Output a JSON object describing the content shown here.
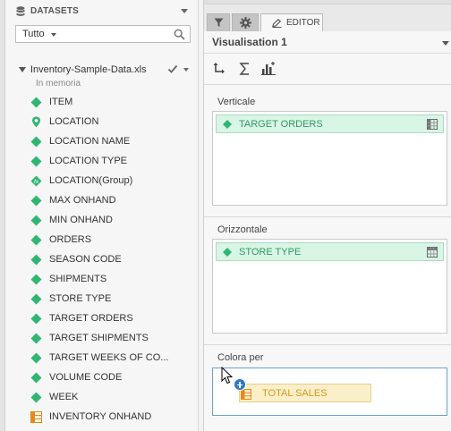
{
  "datasets": {
    "title": "DATASETS",
    "filter_value": "Tutto",
    "file_name": "Inventory-Sample-Data.xls",
    "file_status": "In memoria",
    "fields": [
      {
        "label": "ITEM",
        "type": "dimension",
        "icon": "diamond-icon"
      },
      {
        "label": "LOCATION",
        "type": "geo",
        "icon": "location-pin-icon"
      },
      {
        "label": "LOCATION NAME",
        "type": "dimension",
        "icon": "diamond-icon"
      },
      {
        "label": "LOCATION TYPE",
        "type": "dimension",
        "icon": "diamond-icon"
      },
      {
        "label": "LOCATION(Group)",
        "type": "calculated",
        "icon": "fx-icon"
      },
      {
        "label": "MAX ONHAND",
        "type": "dimension",
        "icon": "diamond-icon"
      },
      {
        "label": "MIN ONHAND",
        "type": "dimension",
        "icon": "diamond-icon"
      },
      {
        "label": "ORDERS",
        "type": "dimension",
        "icon": "diamond-icon"
      },
      {
        "label": "SEASON CODE",
        "type": "dimension",
        "icon": "diamond-icon"
      },
      {
        "label": "SHIPMENTS",
        "type": "dimension",
        "icon": "diamond-icon"
      },
      {
        "label": "STORE TYPE",
        "type": "dimension",
        "icon": "diamond-icon"
      },
      {
        "label": "TARGET ORDERS",
        "type": "dimension",
        "icon": "diamond-icon"
      },
      {
        "label": "TARGET SHIPMENTS",
        "type": "dimension",
        "icon": "diamond-icon"
      },
      {
        "label": "TARGET WEEKS OF CO...",
        "type": "dimension",
        "icon": "diamond-icon"
      },
      {
        "label": "VOLUME CODE",
        "type": "dimension",
        "icon": "diamond-icon"
      },
      {
        "label": "WEEK",
        "type": "dimension",
        "icon": "diamond-icon"
      },
      {
        "label": "INVENTORY ONHAND",
        "type": "measure",
        "icon": "measure-icon"
      },
      {
        "label": "",
        "type": "measure",
        "icon": "measure-icon"
      }
    ]
  },
  "editor": {
    "tabs": {
      "filter_icon": "filter-icon",
      "settings_icon": "gear-icon",
      "editor_label": "EDITOR"
    },
    "visualisation_title": "Visualisation 1",
    "toolbar": [
      "swap-axes-icon",
      "sum-icon",
      "chart-type-icon"
    ],
    "zones": {
      "vertical": {
        "label": "Verticale",
        "pill": "TARGET ORDERS"
      },
      "horizontal": {
        "label": "Orizzontale",
        "pill": "STORE TYPE"
      },
      "color": {
        "label": "Colora per",
        "dragging_pill": "TOTAL SALES"
      }
    }
  },
  "colors": {
    "dimension": "#2fb673",
    "measure": "#e48a1c",
    "drop_highlight": "#6a9fce"
  }
}
